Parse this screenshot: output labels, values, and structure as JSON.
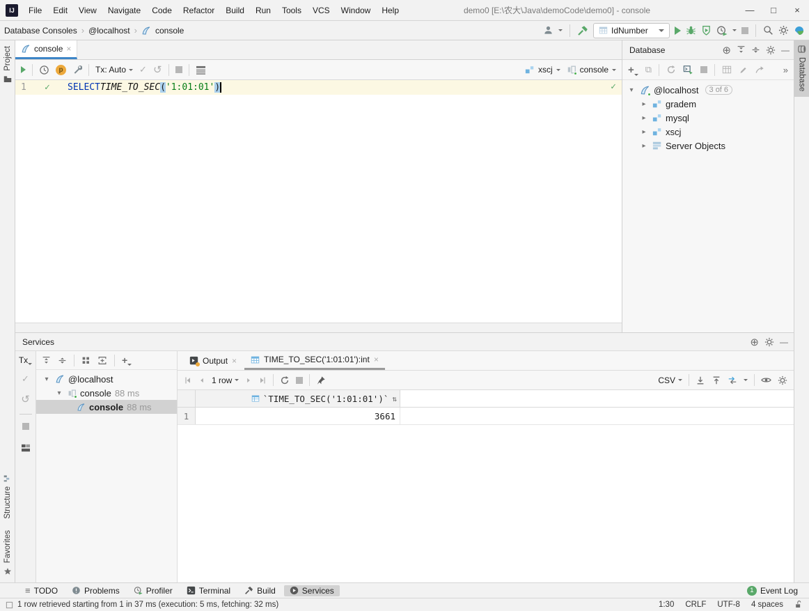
{
  "window": {
    "logo": "IJ",
    "title": "demo0 [E:\\农大\\Java\\demoCode\\demo0] - console",
    "menus": [
      "File",
      "Edit",
      "View",
      "Navigate",
      "Code",
      "Refactor",
      "Build",
      "Run",
      "Tools",
      "VCS",
      "Window",
      "Help"
    ]
  },
  "navbar": {
    "breadcrumbs": [
      "Database Consoles",
      "@localhost",
      "console"
    ],
    "run_config": "IdNumber"
  },
  "stripes": {
    "project": "Project",
    "structure": "Structure",
    "favorites": "Favorites",
    "database": "Database"
  },
  "editor": {
    "tab_label": "console",
    "tx_label": "Tx: Auto",
    "schema_selector": "xscj",
    "session_selector": "console",
    "line_number": "1",
    "code_keyword": "SELECT",
    "code_function": " TIME_TO_SEC",
    "code_open_paren": "(",
    "code_string": "'1:01:01'",
    "code_close_paren": ")"
  },
  "database_panel": {
    "title": "Database",
    "root_label": "@localhost",
    "root_badge": "3 of 6",
    "schema_1": "gradem",
    "schema_2": "mysql",
    "schema_3": "xscj",
    "server_objects": "Server Objects"
  },
  "services": {
    "title": "Services",
    "tx_label": "Tx",
    "tree": [
      {
        "label": "@localhost",
        "time": ""
      },
      {
        "label": "console",
        "time": "88 ms"
      },
      {
        "label": "console",
        "time": "88 ms"
      }
    ],
    "output_tab": "Output",
    "result_tab": "TIME_TO_SEC('1:01:01'):int",
    "pager_rows": "1 row",
    "csv_label": "CSV",
    "grid_header": "`TIME_TO_SEC('1:01:01')`",
    "row_number": "1",
    "row_value": "3661"
  },
  "bottom_bar": {
    "todo": "TODO",
    "problems": "Problems",
    "profiler": "Profiler",
    "terminal": "Terminal",
    "build": "Build",
    "services": "Services",
    "event_log": "Event Log",
    "event_count": "1"
  },
  "status_bar": {
    "message": "1 row retrieved starting from 1 in 37 ms (execution: 5 ms, fetching: 32 ms)",
    "caret": "1:30",
    "line_sep": "CRLF",
    "encoding": "UTF-8",
    "indent": "4 spaces"
  },
  "icons": {
    "close": "×",
    "chevron": "›",
    "double_chevron": "»",
    "tree_expanded": "▾",
    "tree_collapsed": "▸",
    "minimize": "—",
    "maximize": "□",
    "window_close": "×",
    "check": "✓",
    "rollback": "↺",
    "menu_list": "≡",
    "plus": "+",
    "sort": "⇅",
    "locate": "⊕",
    "copy": "⧉"
  }
}
